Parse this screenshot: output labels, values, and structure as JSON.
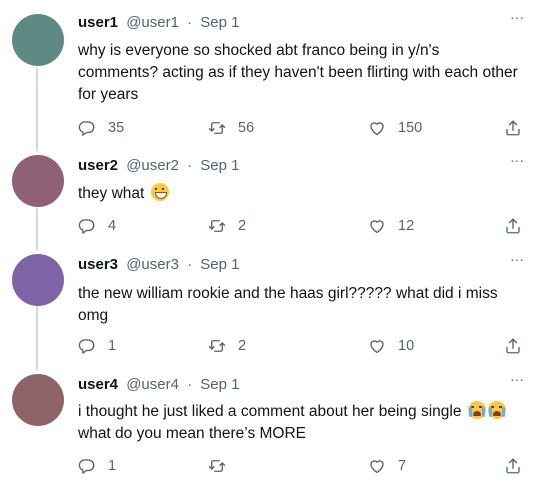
{
  "tweets": [
    {
      "name": "user1",
      "handle": "@user1",
      "date": "Sep 1",
      "text": "why is everyone so shocked abt franco being in y/n's comments? acting as if they haven't been flirting with each other for years",
      "emoji": "",
      "replies": "35",
      "retweets": "56",
      "likes": "150",
      "avatar_color": "#5f8a84"
    },
    {
      "name": "user2",
      "handle": "@user2",
      "date": "Sep 1",
      "text": "they what",
      "emoji": "grinning-face-emoji",
      "replies": "4",
      "retweets": "2",
      "likes": "12",
      "avatar_color": "#8f6076"
    },
    {
      "name": "user3",
      "handle": "@user3",
      "date": "Sep 1",
      "text": "the new william rookie and the haas girl????? what did i miss omg",
      "emoji": "",
      "replies": "1",
      "retweets": "2",
      "likes": "10",
      "avatar_color": "#7e63a6"
    },
    {
      "name": "user4",
      "handle": "@user4",
      "date": "Sep 1",
      "text_line1": "i thought he just liked a comment about her being single",
      "text_line2": "what do you mean there’s MORE",
      "emoji": "loudly-crying-face-emoji x2",
      "replies": "1",
      "retweets": "",
      "likes": "7",
      "avatar_color": "#8e6566"
    }
  ],
  "separator": "·",
  "more_glyph": "···"
}
